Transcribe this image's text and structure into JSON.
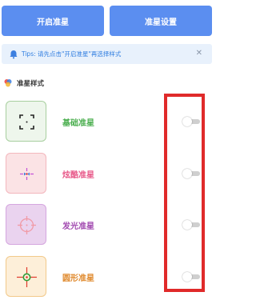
{
  "buttons": {
    "start": "开启准星",
    "settings": "准星设置"
  },
  "tips": {
    "text": "Tips: 请先点击\"开启准星\"再选择样式",
    "close_glyph": "✕",
    "icon": "bell-icon"
  },
  "section": {
    "title": "准星样式",
    "icon": "palette-icon"
  },
  "styles": [
    {
      "label": "基础准星",
      "label_color": "#4caf50",
      "thumb_bg": "#eef6ec",
      "thumb_border": "#a8cf9f",
      "icon": "basic-crosshair-icon",
      "enabled": false
    },
    {
      "label": "炫酷准星",
      "label_color": "#e85a8a",
      "thumb_bg": "#fbe3e5",
      "thumb_border": "#f3b7bd",
      "icon": "cool-crosshair-icon",
      "enabled": false
    },
    {
      "label": "发光准星",
      "label_color": "#a24ab0",
      "thumb_bg": "#ead3ef",
      "thumb_border": "#d5a6df",
      "icon": "glow-crosshair-icon",
      "enabled": false
    },
    {
      "label": "圆形准星",
      "label_color": "#e08a2e",
      "thumb_bg": "#fdefd9",
      "thumb_border": "#f2c98a",
      "icon": "circle-crosshair-icon",
      "enabled": false
    }
  ],
  "colors": {
    "primary": "#5b8ef0",
    "highlight": "#e02a2a"
  }
}
